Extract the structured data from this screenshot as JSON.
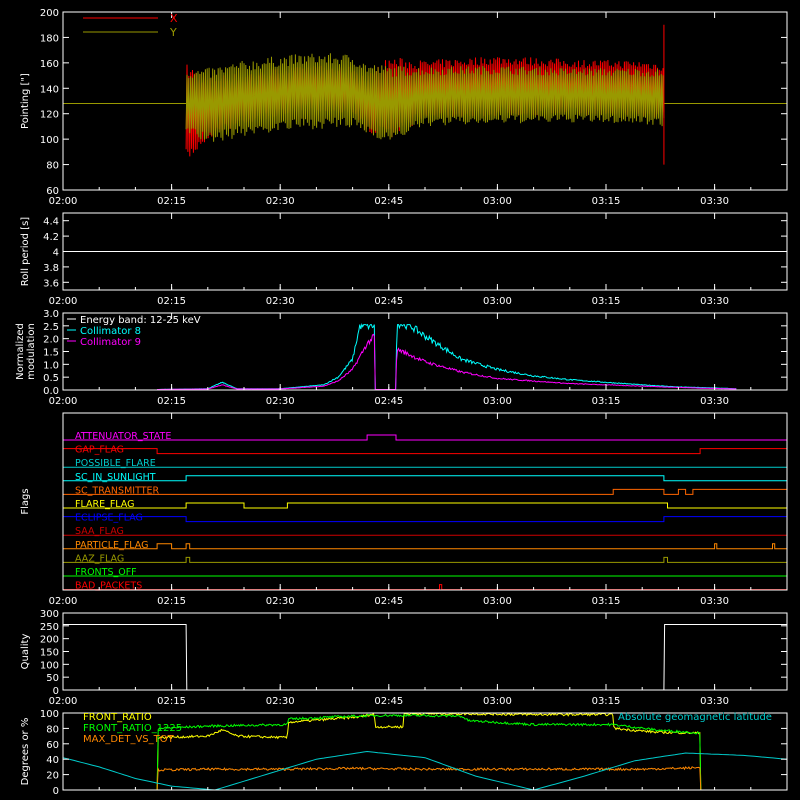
{
  "chart_data": [
    {
      "type": "line",
      "ylabel": "Pointing [\"]",
      "ylim": [
        60,
        200
      ],
      "yticks": [
        60,
        80,
        100,
        120,
        140,
        160,
        180,
        200
      ],
      "xlim": [
        "02:00",
        "03:40"
      ],
      "xticks": [
        "02:00",
        "02:15",
        "02:30",
        "02:45",
        "03:00",
        "03:15",
        "03:30"
      ],
      "legend": [
        {
          "name": "X",
          "color": "#ff0000"
        },
        {
          "name": "Y",
          "color": "#999900"
        }
      ],
      "baseline": 128,
      "data_start": "02:17",
      "data_end": "03:23",
      "series": [
        {
          "name": "X",
          "color": "#ff0000",
          "x": [
            "02:17",
            "02:20",
            "02:25",
            "02:30",
            "02:35",
            "02:40",
            "02:42",
            "02:45",
            "02:50",
            "03:00",
            "03:10",
            "03:20",
            "03:23"
          ],
          "upper": [
            160,
            150,
            152,
            156,
            158,
            157,
            150,
            165,
            162,
            166,
            163,
            162,
            160
          ],
          "lower": [
            80,
            100,
            112,
            118,
            122,
            120,
            105,
            100,
            116,
            118,
            119,
            118,
            115
          ]
        },
        {
          "name": "Y",
          "color": "#999900",
          "x": [
            "02:17",
            "02:20",
            "02:25",
            "02:30",
            "02:35",
            "02:40",
            "02:42",
            "02:45",
            "02:50",
            "03:00",
            "03:10",
            "03:20",
            "03:23"
          ],
          "upper": [
            155,
            156,
            162,
            166,
            168,
            167,
            160,
            158,
            157,
            158,
            156,
            156,
            155
          ],
          "lower": [
            105,
            96,
            102,
            106,
            108,
            108,
            104,
            97,
            110,
            112,
            113,
            112,
            110
          ]
        }
      ]
    },
    {
      "type": "line",
      "ylabel": "Roll period [s]",
      "ylim": [
        3.5,
        4.5
      ],
      "yticks": [
        3.6,
        3.8,
        4.0,
        4.2,
        4.4
      ],
      "xticks": [
        "02:00",
        "02:15",
        "02:30",
        "02:45",
        "03:00",
        "03:15",
        "03:30"
      ],
      "series": [
        {
          "color": "#ffffff",
          "x": [
            "02:00",
            "03:40"
          ],
          "y": [
            4.0,
            4.0
          ]
        }
      ]
    },
    {
      "type": "line",
      "ylabel": "Normalized modulation",
      "ylim": [
        0,
        3.0
      ],
      "yticks": [
        "0.0",
        "0.5",
        "1.0",
        "1.5",
        "2.0",
        "2.5",
        "3.0"
      ],
      "xticks": [
        "02:00",
        "02:15",
        "02:30",
        "02:45",
        "03:00",
        "03:15",
        "03:30"
      ],
      "legend": [
        {
          "name": "Energy band: 12-25 keV",
          "color": "#ffffff"
        },
        {
          "name": "Collimator 8",
          "color": "#00ffff"
        },
        {
          "name": "Collimator 9",
          "color": "#ff00ff"
        }
      ],
      "series": [
        {
          "name": "Collimator 8",
          "color": "#00ffff",
          "x": [
            "02:13",
            "02:20",
            "02:22",
            "02:24",
            "02:30",
            "02:36",
            "02:38",
            "02:40",
            "02:41",
            "02:42",
            "02:43",
            "02:43.1",
            "02:46",
            "02:46.1",
            "02:48",
            "02:50",
            "02:55",
            "03:00",
            "03:05",
            "03:10",
            "03:15",
            "03:20",
            "03:25",
            "03:30",
            "03:33"
          ],
          "y": [
            0.02,
            0.05,
            0.3,
            0.05,
            0.05,
            0.2,
            0.5,
            1.2,
            2.5,
            2.5,
            2.5,
            0.02,
            0.02,
            2.6,
            2.5,
            2.1,
            1.2,
            0.8,
            0.55,
            0.4,
            0.3,
            0.2,
            0.12,
            0.08,
            0.05
          ]
        },
        {
          "name": "Collimator 9",
          "color": "#ff00ff",
          "x": [
            "02:13",
            "02:20",
            "02:22",
            "02:24",
            "02:30",
            "02:36",
            "02:38",
            "02:40",
            "02:42",
            "02:43",
            "02:43.1",
            "02:46",
            "02:46.1",
            "02:50",
            "02:55",
            "03:00",
            "03:05",
            "03:10",
            "03:15",
            "03:20",
            "03:25",
            "03:30",
            "03:33"
          ],
          "y": [
            0.02,
            0.04,
            0.2,
            0.04,
            0.04,
            0.15,
            0.35,
            0.8,
            1.8,
            2.1,
            0.02,
            0.02,
            1.6,
            1.1,
            0.7,
            0.45,
            0.35,
            0.25,
            0.2,
            0.15,
            0.1,
            0.06,
            0.04
          ]
        }
      ]
    },
    {
      "type": "line",
      "ylabel": "Flags",
      "xticks": [
        "02:00",
        "02:15",
        "02:30",
        "02:45",
        "03:00",
        "03:15",
        "03:30"
      ],
      "flags": [
        {
          "name": "ATTENUATOR_STATE",
          "color": "#ff00ff",
          "steps": [
            [
              "02:00",
              0
            ],
            [
              "02:42",
              1
            ],
            [
              "02:46",
              0
            ],
            [
              "03:40",
              0
            ]
          ]
        },
        {
          "name": "GAP_FLAG",
          "color": "#ff0000",
          "steps": [
            [
              "02:00",
              1
            ],
            [
              "02:13",
              0
            ],
            [
              "03:28",
              1
            ],
            [
              "03:40",
              1
            ]
          ]
        },
        {
          "name": "POSSIBLE_FLARE",
          "color": "#00cccc",
          "steps": [
            [
              "02:00",
              0
            ],
            [
              "03:40",
              0
            ]
          ]
        },
        {
          "name": "SC_IN_SUNLIGHT",
          "color": "#00ffff",
          "steps": [
            [
              "02:00",
              0
            ],
            [
              "02:17",
              1
            ],
            [
              "03:23",
              0
            ],
            [
              "03:40",
              0
            ]
          ]
        },
        {
          "name": "SC_TRANSMITTER",
          "color": "#ff6600",
          "steps": [
            [
              "02:00",
              0
            ],
            [
              "03:16",
              1
            ],
            [
              "03:23",
              0
            ],
            [
              "03:25",
              1
            ],
            [
              "03:26",
              0
            ],
            [
              "03:27",
              1
            ],
            [
              "03:40",
              1
            ]
          ]
        },
        {
          "name": "FLARE_FLAG",
          "color": "#ffff00",
          "steps": [
            [
              "02:00",
              0
            ],
            [
              "02:17",
              1
            ],
            [
              "02:25",
              0
            ],
            [
              "02:31",
              1
            ],
            [
              "02:40",
              1
            ],
            [
              "03:23",
              1
            ],
            [
              "03:23.5",
              0
            ],
            [
              "03:40",
              0
            ]
          ]
        },
        {
          "name": "ECLIPSE_FLAG",
          "color": "#0000ff",
          "steps": [
            [
              "02:00",
              1
            ],
            [
              "02:17",
              0
            ],
            [
              "03:23",
              1
            ],
            [
              "03:40",
              1
            ]
          ]
        },
        {
          "name": "SAA_FLAG",
          "color": "#cc0000",
          "steps": [
            [
              "02:00",
              0
            ],
            [
              "03:40",
              0
            ]
          ]
        },
        {
          "name": "PARTICLE_FLAG",
          "color": "#ff8800",
          "steps": [
            [
              "02:00",
              0
            ],
            [
              "02:13",
              1
            ],
            [
              "02:15",
              0
            ],
            [
              "02:17",
              1
            ],
            [
              "02:17.5",
              0
            ],
            [
              "03:30",
              1
            ],
            [
              "03:30.3",
              0
            ],
            [
              "03:38",
              1
            ],
            [
              "03:38.3",
              0
            ],
            [
              "03:40",
              0
            ]
          ]
        },
        {
          "name": "AAZ_FLAG",
          "color": "#999900",
          "steps": [
            [
              "02:00",
              0
            ],
            [
              "02:17",
              1
            ],
            [
              "02:17.5",
              0
            ],
            [
              "03:23",
              1
            ],
            [
              "03:23.5",
              0
            ],
            [
              "03:40",
              0
            ]
          ]
        },
        {
          "name": "FRONTS_OFF",
          "color": "#00ff00",
          "steps": [
            [
              "02:00",
              0
            ],
            [
              "03:40",
              0
            ]
          ]
        },
        {
          "name": "BAD_PACKETS",
          "color": "#ff0000",
          "steps": [
            [
              "02:00",
              0
            ],
            [
              "02:52",
              1
            ],
            [
              "02:52.3",
              0
            ],
            [
              "03:40",
              0
            ]
          ]
        }
      ]
    },
    {
      "type": "line",
      "ylabel": "Quality",
      "ylim": [
        0,
        300
      ],
      "yticks": [
        0,
        50,
        100,
        150,
        200,
        250,
        300
      ],
      "xticks": [
        "02:00",
        "02:15",
        "02:30",
        "02:45",
        "03:00",
        "03:15",
        "03:30"
      ],
      "series": [
        {
          "color": "#ffffff",
          "x": [
            "02:00",
            "02:17",
            "02:17.1",
            "03:23",
            "03:23.1",
            "03:40"
          ],
          "y": [
            255,
            255,
            0,
            0,
            255,
            255
          ]
        }
      ]
    },
    {
      "type": "line",
      "ylabel": "Degrees or %",
      "ylim": [
        0,
        100
      ],
      "yticks": [
        0,
        20,
        40,
        60,
        80,
        100
      ],
      "legend_left": [
        {
          "name": "FRONT_RATIO",
          "color": "#ffff00"
        },
        {
          "name": "FRONT_RATIO_1225",
          "color": "#00ff00"
        },
        {
          "name": "MAX_DET_VS_TOT",
          "color": "#ff8800"
        }
      ],
      "legend_right": {
        "name": "Absolute geomagnetic latitude",
        "color": "#00cccc"
      },
      "series": [
        {
          "name": "FRONT_RATIO",
          "color": "#ffff00",
          "x": [
            "02:13",
            "02:13.1",
            "02:20",
            "02:22",
            "02:24",
            "02:31",
            "02:31.1",
            "02:41",
            "02:43",
            "02:43.1",
            "02:47",
            "02:47.1",
            "02:55",
            "03:05",
            "03:16",
            "03:16.1",
            "03:22",
            "03:28",
            "03:28.1"
          ],
          "y": [
            0,
            68,
            70,
            78,
            70,
            68,
            88,
            95,
            99,
            82,
            82,
            99,
            99,
            98,
            98,
            80,
            75,
            74,
            0
          ]
        },
        {
          "name": "FRONT_RATIO_1225",
          "color": "#00ff00",
          "x": [
            "02:13",
            "02:13.1",
            "02:20",
            "02:31",
            "02:31.1",
            "02:40",
            "02:45",
            "02:55",
            "02:56",
            "03:05",
            "03:16",
            "03:22",
            "03:28",
            "03:28.1"
          ],
          "y": [
            0,
            80,
            83,
            85,
            92,
            96,
            97,
            96,
            90,
            85,
            85,
            78,
            74,
            0
          ]
        },
        {
          "name": "MAX_DET_VS_TOT",
          "color": "#ff8800",
          "x": [
            "02:13",
            "02:13.1",
            "02:20",
            "02:30",
            "02:40",
            "02:50",
            "03:00",
            "03:10",
            "03:20",
            "03:28",
            "03:28.1"
          ],
          "y": [
            0,
            26,
            27,
            27,
            28,
            27,
            27,
            27,
            27,
            29,
            0
          ]
        },
        {
          "name": "Absolute geomagnetic latitude",
          "color": "#00cccc",
          "x": [
            "02:00",
            "02:05",
            "02:10",
            "02:15",
            "02:21",
            "02:28",
            "02:35",
            "02:42",
            "02:50",
            "02:57",
            "03:05",
            "03:12",
            "03:19",
            "03:26",
            "03:34",
            "03:40"
          ],
          "y": [
            42,
            30,
            15,
            5,
            0,
            20,
            40,
            50,
            42,
            18,
            0,
            18,
            38,
            48,
            45,
            40
          ]
        }
      ]
    }
  ]
}
